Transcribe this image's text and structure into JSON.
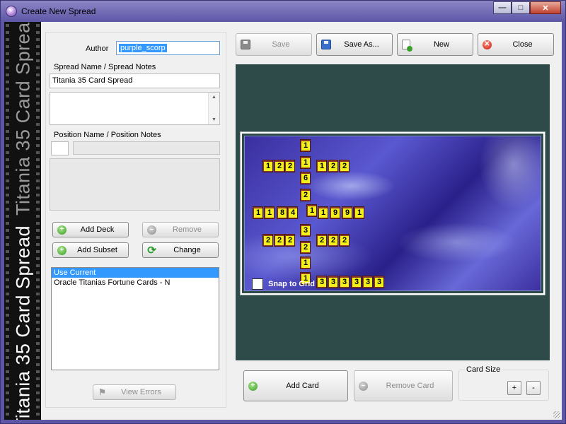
{
  "window": {
    "title": "Create New Spread",
    "controls": {
      "minimize": "—",
      "maximize": "□",
      "close": "✕"
    }
  },
  "strip": {
    "primary": "Titania 35 Card Spread",
    "secondary": "Titania 35 Card Spread"
  },
  "form": {
    "author_label": "Author",
    "author_value": "purple_scorp",
    "spread_name_label": "Spread Name / Spread Notes",
    "spread_name_value": "Titania 35 Card Spread",
    "position_label": "Position Name / Position Notes"
  },
  "deck_buttons": {
    "add_deck": "Add Deck",
    "remove": "Remove",
    "add_subset": "Add Subset",
    "change": "Change"
  },
  "deck_list": [
    "Use Current",
    "Oracle Titanias Fortune Cards - N"
  ],
  "view_errors": "View Errors",
  "toolbar": {
    "save": "Save",
    "save_as": "Save As...",
    "new": "New",
    "close": "Close"
  },
  "board": {
    "snap_label": "Snap to Grid",
    "cards": [
      {
        "label": "1"
      },
      {
        "label": "2"
      },
      {
        "label": "2"
      },
      {
        "label": "1"
      },
      {
        "label": "1"
      },
      {
        "label": "6"
      },
      {
        "label": "2"
      },
      {
        "label": "1"
      },
      {
        "label": "3"
      },
      {
        "label": "2"
      },
      {
        "label": "1"
      },
      {
        "label": "1"
      },
      {
        "label": "1"
      },
      {
        "label": "2"
      },
      {
        "label": "2"
      },
      {
        "label": "1"
      },
      {
        "label": "1"
      },
      {
        "label": "8"
      },
      {
        "label": "4"
      },
      {
        "label": "1"
      },
      {
        "label": "9"
      },
      {
        "label": "9"
      },
      {
        "label": "1"
      },
      {
        "label": "1"
      },
      {
        "label": "2"
      },
      {
        "label": "2"
      },
      {
        "label": "2"
      },
      {
        "label": "2"
      },
      {
        "label": "2"
      },
      {
        "label": "2"
      },
      {
        "label": "3"
      },
      {
        "label": "3"
      },
      {
        "label": "3"
      },
      {
        "label": "3"
      },
      {
        "label": "3"
      },
      {
        "label": "3"
      }
    ]
  },
  "bottom": {
    "add_card": "Add Card",
    "remove_card": "Remove Card",
    "card_size_label": "Card Size",
    "size_plus": "+",
    "size_minus": "-"
  }
}
